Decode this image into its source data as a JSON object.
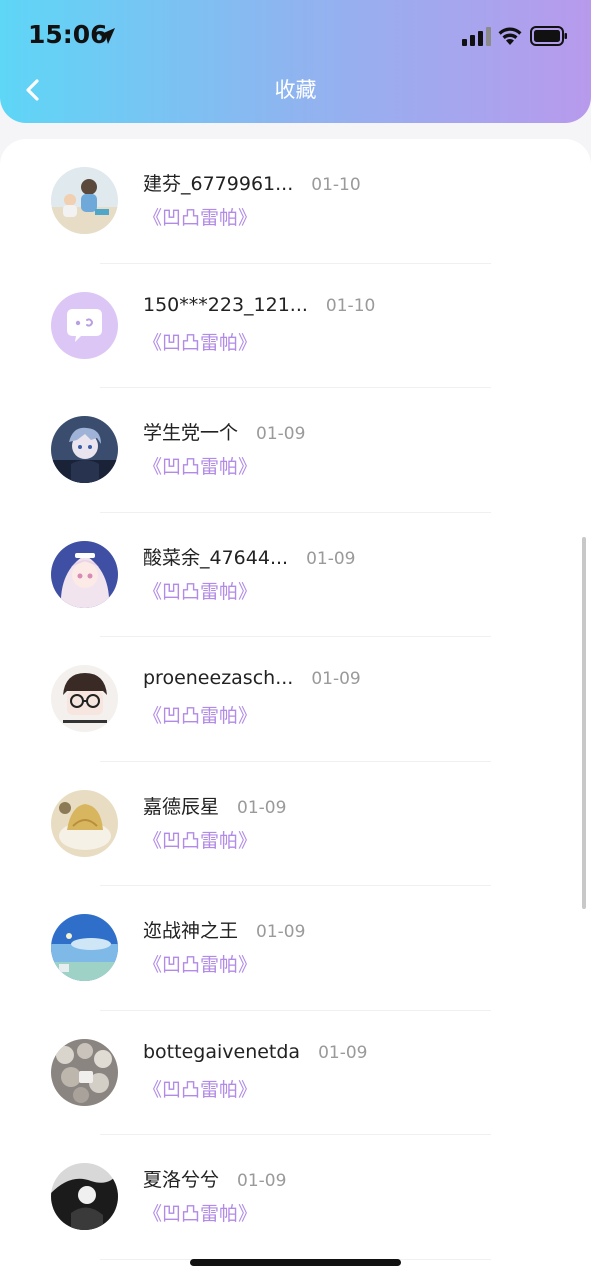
{
  "status_bar": {
    "time": "15:06"
  },
  "header": {
    "title": "收藏"
  },
  "colors": {
    "header_gradient_start": "#5ed6f6",
    "header_gradient_end": "#b89aec",
    "work_title": "#b28be6",
    "date": "#9a9a9a"
  },
  "items": [
    {
      "name": "建芬_6779961...",
      "date": "01-10",
      "work": "《凹凸雷帕》",
      "avatar": "photo-avatar-child"
    },
    {
      "name": "150***223_121...",
      "date": "01-10",
      "work": "《凹凸雷帕》",
      "avatar": "default-chat-avatar"
    },
    {
      "name": "学生党一个",
      "date": "01-09",
      "work": "《凹凸雷帕》",
      "avatar": "anime-avatar-dark"
    },
    {
      "name": "酸菜余_47644...",
      "date": "01-09",
      "work": "《凹凸雷帕》",
      "avatar": "anime-avatar-maid"
    },
    {
      "name": "proeneezasch...",
      "date": "01-09",
      "work": "《凹凸雷帕》",
      "avatar": "photo-avatar-glasses"
    },
    {
      "name": "嘉德辰星",
      "date": "01-09",
      "work": "《凹凸雷帕》",
      "avatar": "photo-avatar-food"
    },
    {
      "name": "迩战神之王",
      "date": "01-09",
      "work": "《凹凸雷帕》",
      "avatar": "photo-avatar-sky"
    },
    {
      "name": "bottegaivenetda",
      "date": "01-09",
      "work": "《凹凸雷帕》",
      "avatar": "photo-avatar-flowers"
    },
    {
      "name": "夏洛兮兮",
      "date": "01-09",
      "work": "《凹凸雷帕》",
      "avatar": "photo-avatar-bw"
    }
  ]
}
